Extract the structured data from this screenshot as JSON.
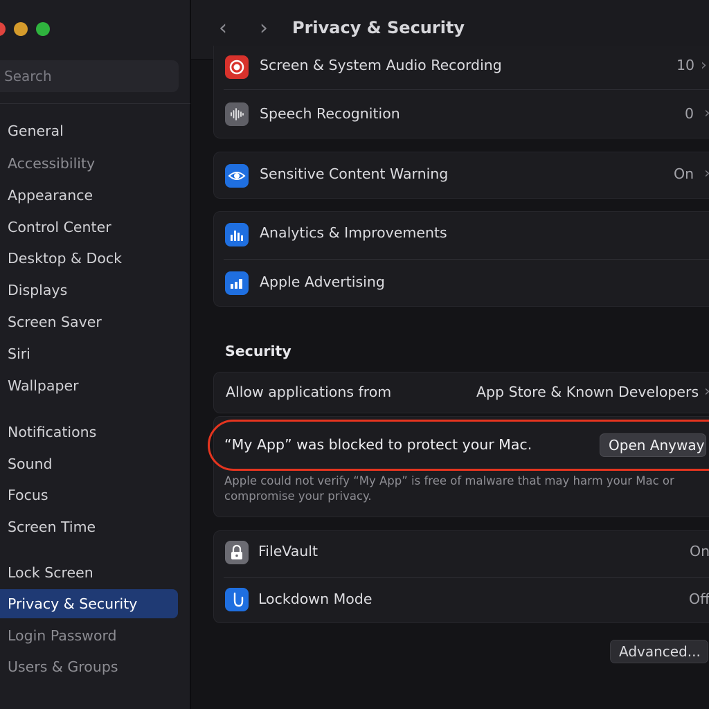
{
  "window": {
    "title": "Privacy & Security",
    "back_glyph": "‹",
    "forward_glyph": "›"
  },
  "search": {
    "placeholder": "Search"
  },
  "sidebar": {
    "items": [
      {
        "label": "General"
      },
      {
        "label": "Accessibility"
      },
      {
        "label": "Appearance"
      },
      {
        "label": "Control Center"
      },
      {
        "label": "Desktop & Dock"
      },
      {
        "label": "Displays"
      },
      {
        "label": "Screen Saver"
      },
      {
        "label": "Siri"
      },
      {
        "label": "Wallpaper"
      },
      {
        "label": "Notifications"
      },
      {
        "label": "Sound"
      },
      {
        "label": "Focus"
      },
      {
        "label": "Screen Time"
      },
      {
        "label": "Lock Screen"
      },
      {
        "label": "Privacy & Security",
        "active": true
      },
      {
        "label": "Login Password"
      },
      {
        "label": "Users & Groups"
      }
    ]
  },
  "privacy_rows": {
    "screen_recording": {
      "label": "Screen & System Audio Recording",
      "value": "10",
      "icon": "record-icon"
    },
    "speech": {
      "label": "Speech Recognition",
      "value": "0",
      "icon": "waveform-icon"
    },
    "sensitive": {
      "label": "Sensitive Content Warning",
      "value": "On",
      "icon": "eye-icon"
    },
    "analytics": {
      "label": "Analytics & Improvements",
      "icon": "bar-chart-icon"
    },
    "advertising": {
      "label": "Apple Advertising",
      "icon": "megaphone-icon"
    }
  },
  "security": {
    "section_title": "Security",
    "allow_label": "Allow applications from",
    "allow_value": "App Store & Known Developers",
    "blocked_message": "“My App” was blocked to protect your Mac.",
    "open_anyway_label": "Open Anyway",
    "warning": "Apple could not verify “My App” is free of malware that may harm your Mac or compromise your privacy.",
    "filevault": {
      "label": "FileVault",
      "value": "On",
      "icon": "lock-icon"
    },
    "lockdown": {
      "label": "Lockdown Mode",
      "value": "Off",
      "icon": "hand-icon"
    }
  },
  "footer": {
    "advanced_label": "Advanced..."
  },
  "colors": {
    "accent_selected": "#1f3a74",
    "highlight_ring": "#e5351f",
    "icon_red": "#d8322c",
    "icon_blue": "#1f6fe0",
    "icon_gray": "#6b6b72"
  }
}
